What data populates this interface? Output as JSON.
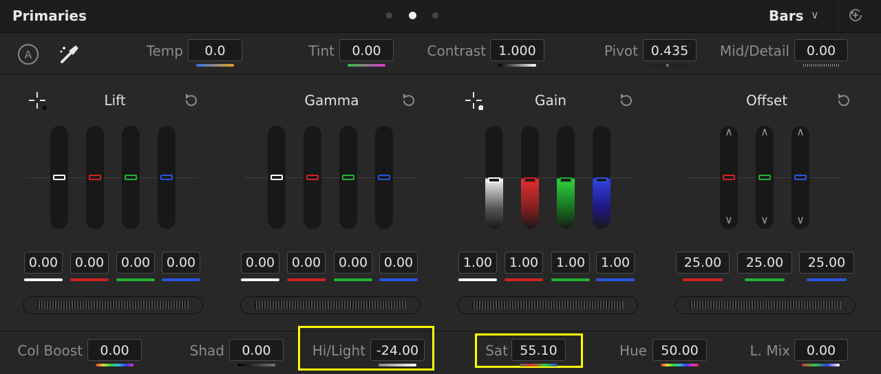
{
  "header": {
    "title": "Primaries",
    "mode": "Bars",
    "page_dots": 3,
    "active_page_dot": 1
  },
  "params": {
    "temp": {
      "label": "Temp",
      "value": "0.0"
    },
    "tint": {
      "label": "Tint",
      "value": "0.00"
    },
    "contrast": {
      "label": "Contrast",
      "value": "1.000"
    },
    "pivot": {
      "label": "Pivot",
      "value": "0.435"
    },
    "mid_detail": {
      "label": "Mid/Detail",
      "value": "0.00"
    }
  },
  "wheels": {
    "lift": {
      "title": "Lift",
      "values": [
        "0.00",
        "0.00",
        "0.00",
        "0.00"
      ]
    },
    "gamma": {
      "title": "Gamma",
      "values": [
        "0.00",
        "0.00",
        "0.00",
        "0.00"
      ]
    },
    "gain": {
      "title": "Gain",
      "values": [
        "1.00",
        "1.00",
        "1.00",
        "1.00"
      ]
    },
    "offset": {
      "title": "Offset",
      "values": [
        "25.00",
        "25.00",
        "25.00"
      ]
    }
  },
  "bottom": {
    "col_boost": {
      "label": "Col Boost",
      "value": "0.00"
    },
    "shad": {
      "label": "Shad",
      "value": "0.00"
    },
    "hi_light": {
      "label": "Hi/Light",
      "value": "-24.00"
    },
    "sat": {
      "label": "Sat",
      "value": "55.10"
    },
    "hue": {
      "label": "Hue",
      "value": "50.00"
    },
    "l_mix": {
      "label": "L. Mix",
      "value": "0.00"
    }
  },
  "colors": {
    "y": "#ffffff",
    "r": "#d32020",
    "g": "#22b432",
    "b": "#2a55e0",
    "highlight": "#ffff00"
  },
  "icons": [
    "auto-balance-icon",
    "eyedropper-icon",
    "reset-icon",
    "picker-crosshair-icon",
    "chevron-down-icon",
    "chevron-up-icon"
  ]
}
